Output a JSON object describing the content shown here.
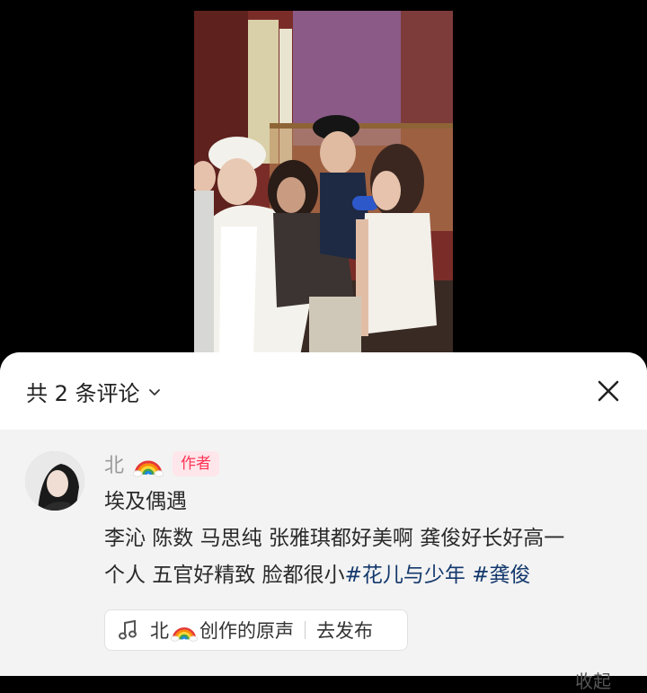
{
  "header": {
    "title": "共 2 条评论"
  },
  "comment": {
    "author": "北",
    "author_badge": "作者",
    "line1": "埃及偶遇",
    "line2": "李沁 陈数 马思纯 张雅琪都好美啊 龚俊好长好高一",
    "line3_prefix": "个人 五官好精致 脸都很小",
    "hashtag1": "#花儿与少年",
    "hashtag2": "#龚俊"
  },
  "sound": {
    "author": "北",
    "suffix": "创作的原声",
    "action": "去发布"
  },
  "footer": {
    "right_partial": "收起"
  },
  "colors": {
    "hashtag": "#13386c",
    "badge_text": "#ff3355",
    "badge_bg": "#ffe6ea"
  },
  "icons": [
    "chevron-down-icon",
    "close-icon",
    "rainbow-emoji",
    "music-note-icon"
  ]
}
